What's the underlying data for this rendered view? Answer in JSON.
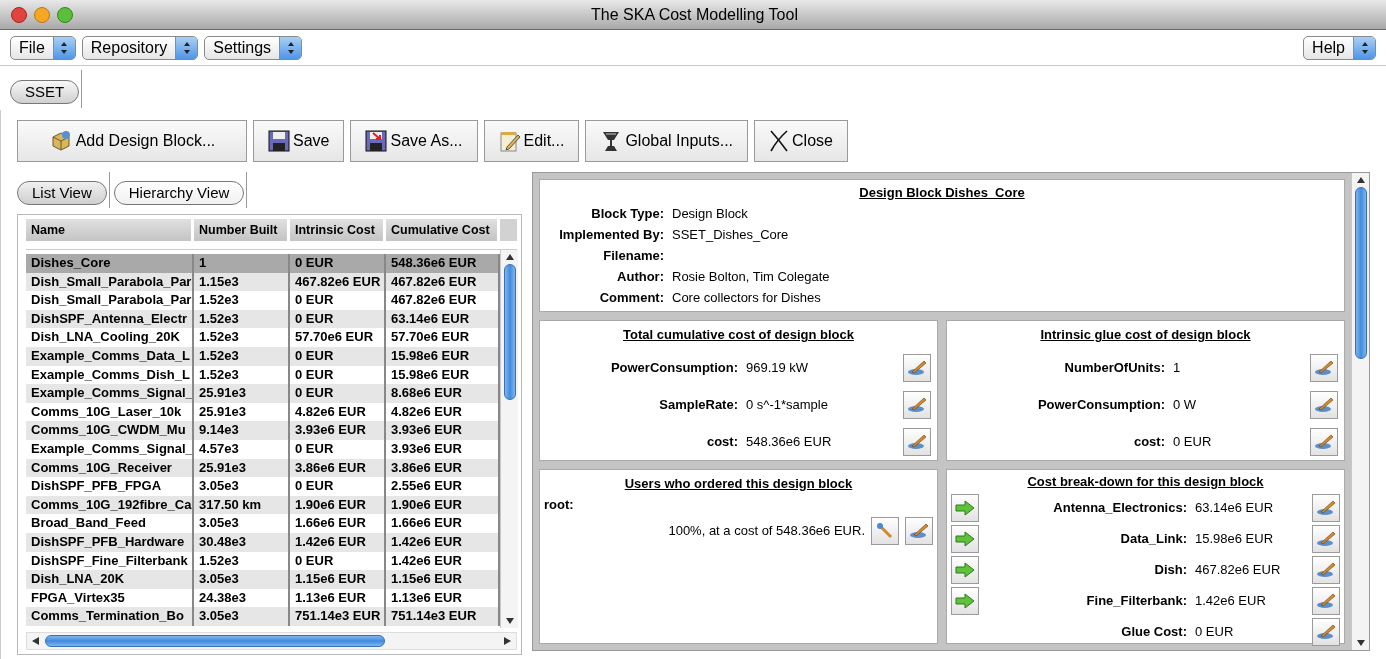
{
  "window": {
    "title": "The SKA Cost Modelling Tool"
  },
  "menus": [
    {
      "label": "File"
    },
    {
      "label": "Repository"
    },
    {
      "label": "Settings"
    }
  ],
  "help_menu": {
    "label": "Help"
  },
  "document_tabs": [
    {
      "label": "SSET",
      "selected": true
    }
  ],
  "toolbar": [
    {
      "label": "Add Design Block...",
      "kind": "add"
    },
    {
      "label": "Save",
      "kind": "save"
    },
    {
      "label": "Save As...",
      "kind": "save_as"
    },
    {
      "label": "Edit...",
      "kind": "edit"
    },
    {
      "label": "Global Inputs...",
      "kind": "global"
    },
    {
      "label": "Close",
      "kind": "close"
    }
  ],
  "view_tabs": [
    {
      "label": "List View",
      "selected": true
    },
    {
      "label": "Hierarchy View",
      "selected": false
    }
  ],
  "table": {
    "columns": [
      "Name",
      "Number Built",
      "Intrinsic Cost",
      "Cumulative Cost"
    ],
    "rows": [
      {
        "cells": [
          "Dishes_Core",
          "1",
          "0 EUR",
          "548.36e6 EUR"
        ],
        "selected": true
      },
      {
        "cells": [
          "Dish_Small_Parabola_Par",
          "1.15e3",
          "467.82e6 EUR",
          "467.82e6 EUR"
        ],
        "selected": false
      },
      {
        "cells": [
          "Dish_Small_Parabola_Par",
          "1.52e3",
          "0 EUR",
          "467.82e6 EUR"
        ],
        "selected": false
      },
      {
        "cells": [
          "DishSPF_Antenna_Electr",
          "1.52e3",
          "0 EUR",
          "63.14e6 EUR"
        ],
        "selected": false
      },
      {
        "cells": [
          "Dish_LNA_Cooling_20K",
          "1.52e3",
          "57.70e6 EUR",
          "57.70e6 EUR"
        ],
        "selected": false
      },
      {
        "cells": [
          "Example_Comms_Data_L",
          "1.52e3",
          "0 EUR",
          "15.98e6 EUR"
        ],
        "selected": false
      },
      {
        "cells": [
          "Example_Comms_Dish_L",
          "1.52e3",
          "0 EUR",
          "15.98e6 EUR"
        ],
        "selected": false
      },
      {
        "cells": [
          "Example_Comms_Signal_",
          "25.91e3",
          "0 EUR",
          "8.68e6 EUR"
        ],
        "selected": false
      },
      {
        "cells": [
          "Comms_10G_Laser_10k",
          "25.91e3",
          "4.82e6 EUR",
          "4.82e6 EUR"
        ],
        "selected": false
      },
      {
        "cells": [
          "Comms_10G_CWDM_Mu",
          "9.14e3",
          "3.93e6 EUR",
          "3.93e6 EUR"
        ],
        "selected": false
      },
      {
        "cells": [
          "Example_Comms_Signal_",
          "4.57e3",
          "0 EUR",
          "3.93e6 EUR"
        ],
        "selected": false
      },
      {
        "cells": [
          "Comms_10G_Receiver",
          "25.91e3",
          "3.86e6 EUR",
          "3.86e6 EUR"
        ],
        "selected": false
      },
      {
        "cells": [
          "DishSPF_PFB_FPGA",
          "3.05e3",
          "0 EUR",
          "2.55e6 EUR"
        ],
        "selected": false
      },
      {
        "cells": [
          "Comms_10G_192fibre_Ca",
          "317.50 km",
          "1.90e6 EUR",
          "1.90e6 EUR"
        ],
        "selected": false
      },
      {
        "cells": [
          "Broad_Band_Feed",
          "3.05e3",
          "1.66e6 EUR",
          "1.66e6 EUR"
        ],
        "selected": false
      },
      {
        "cells": [
          "DishSPF_PFB_Hardware",
          "30.48e3",
          "1.42e6 EUR",
          "1.42e6 EUR"
        ],
        "selected": false
      },
      {
        "cells": [
          "DishSPF_Fine_Filterbank",
          "1.52e3",
          "0 EUR",
          "1.42e6 EUR"
        ],
        "selected": false
      },
      {
        "cells": [
          "Dish_LNA_20K",
          "3.05e3",
          "1.15e6 EUR",
          "1.15e6 EUR"
        ],
        "selected": false
      },
      {
        "cells": [
          "FPGA_Virtex35",
          "24.38e3",
          "1.13e6 EUR",
          "1.13e6 EUR"
        ],
        "selected": false
      },
      {
        "cells": [
          "Comms_Termination_Bo",
          "3.05e3",
          "751.14e3 EUR",
          "751.14e3 EUR"
        ],
        "selected": false
      }
    ]
  },
  "details": {
    "title": "Design Block Dishes_Core",
    "fields": [
      {
        "label": "Block Type:",
        "value": "Design Block"
      },
      {
        "label": "Implemented By:",
        "value": "SSET_Dishes_Core"
      },
      {
        "label": "Filename:"
      },
      {
        "label": "Author:",
        "value": "Rosie Bolton, Tim Colegate"
      },
      {
        "label": "Comment:",
        "value": "Core collectors for Dishes"
      }
    ]
  },
  "cumulative_cost": {
    "title": "Total cumulative cost of design block",
    "rows": [
      {
        "label": "PowerConsumption:",
        "value": "969.19 kW"
      },
      {
        "label": "SampleRate:",
        "value": "0 s^-1*sample"
      },
      {
        "label": "cost:",
        "value": "548.36e6 EUR"
      }
    ]
  },
  "glue_cost": {
    "title": "Intrinsic glue cost of design block",
    "rows": [
      {
        "label": "NumberOfUnits:",
        "value": "1"
      },
      {
        "label": "PowerConsumption:",
        "value": "0 W"
      },
      {
        "label": "cost:",
        "value": "0 EUR"
      }
    ]
  },
  "users": {
    "title": "Users who ordered this design block",
    "user": "root:",
    "orders": [
      {
        "text": "100%, at a cost of 548.36e6 EUR."
      }
    ]
  },
  "breakdown": {
    "title": "Cost break-down for this design block",
    "rows": [
      {
        "label": "Antenna_Electronics:",
        "value": "63.14e6 EUR",
        "kind": "child"
      },
      {
        "label": "Data_Link:",
        "value": "15.98e6 EUR",
        "kind": "child"
      },
      {
        "label": "Dish:",
        "value": "467.82e6 EUR",
        "kind": "child"
      },
      {
        "label": "Fine_Filterbank:",
        "value": "1.42e6 EUR",
        "kind": "child"
      },
      {
        "label": "Glue Cost:",
        "value": "0 EUR",
        "kind": "glue"
      }
    ]
  }
}
